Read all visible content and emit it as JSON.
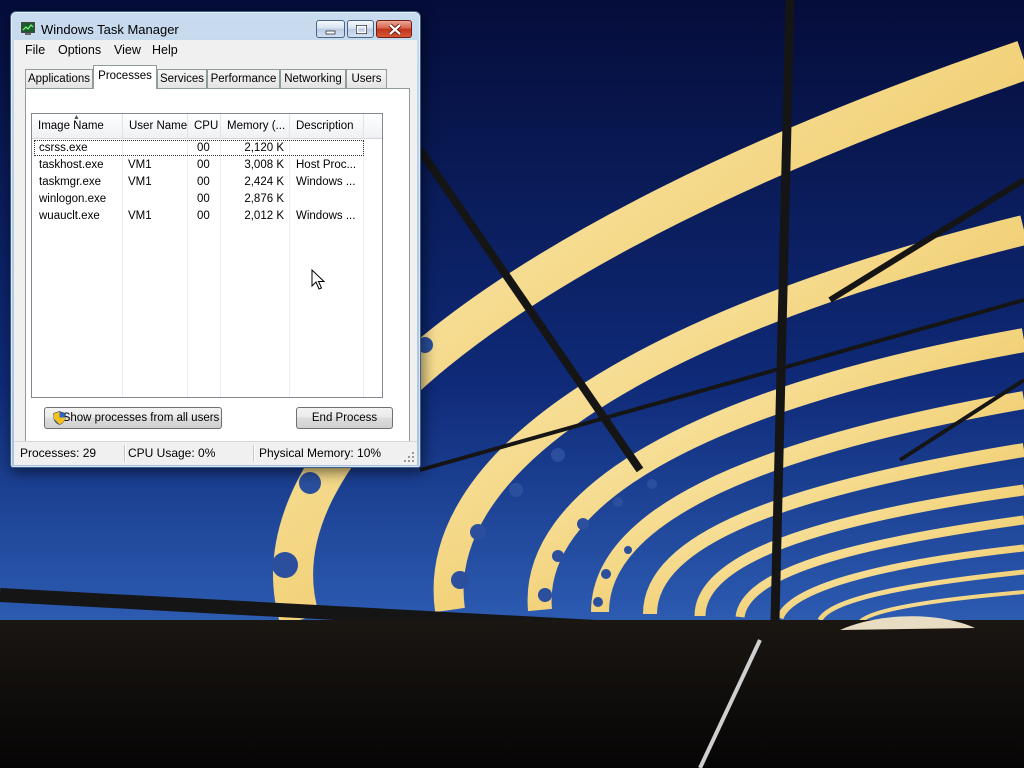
{
  "window": {
    "title": "Windows Task Manager",
    "app_icon": "task-manager-icon"
  },
  "caption_buttons": {
    "minimize": "minimize-icon",
    "maximize": "maximize-icon",
    "close": "close-icon"
  },
  "menu": [
    "File",
    "Options",
    "View",
    "Help"
  ],
  "tabs": [
    {
      "label": "Applications"
    },
    {
      "label": "Processes",
      "active": true
    },
    {
      "label": "Services"
    },
    {
      "label": "Performance"
    },
    {
      "label": "Networking"
    },
    {
      "label": "Users"
    }
  ],
  "processes": {
    "columns": [
      "Image Name",
      "User Name",
      "CPU",
      "Memory (...",
      "Description"
    ],
    "sorted_by": "Image Name",
    "rows": [
      {
        "image": "csrss.exe",
        "user": "",
        "cpu": "00",
        "memory": "2,120 K",
        "description": ""
      },
      {
        "image": "taskhost.exe",
        "user": "VM1",
        "cpu": "00",
        "memory": "3,008 K",
        "description": "Host Proc..."
      },
      {
        "image": "taskmgr.exe",
        "user": "VM1",
        "cpu": "00",
        "memory": "2,424 K",
        "description": "Windows ..."
      },
      {
        "image": "winlogon.exe",
        "user": "",
        "cpu": "00",
        "memory": "2,876 K",
        "description": ""
      },
      {
        "image": "wuauclt.exe",
        "user": "VM1",
        "cpu": "00",
        "memory": "2,012 K",
        "description": "Windows ..."
      }
    ]
  },
  "buttons": {
    "show_all": "Show processes from all users",
    "show_all_icon": "uac-shield-icon",
    "end_process": "End Process"
  },
  "status": {
    "processes": "Processes: 29",
    "cpu": "CPU Usage: 0%",
    "memory": "Physical Memory: 10%"
  },
  "colors": {
    "title_glass": "#b7cde6",
    "close_button": "#c1351b",
    "sky": "#0a1f5c",
    "arch": "#f2d27a"
  }
}
